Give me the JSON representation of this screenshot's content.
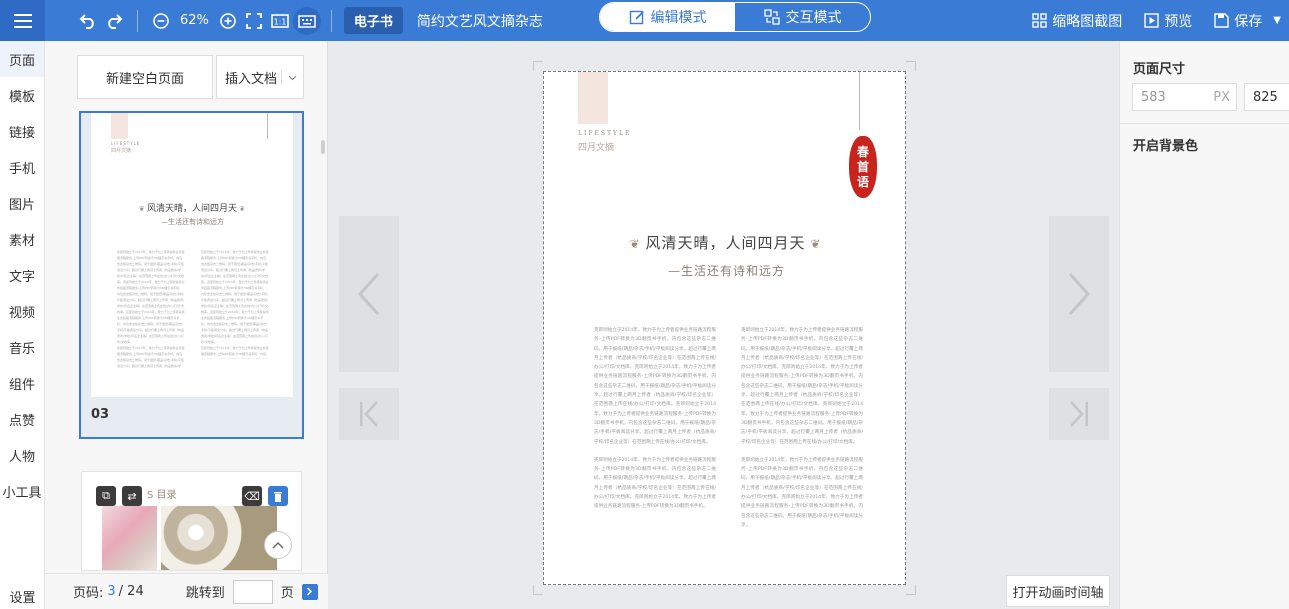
{
  "topbar": {
    "zoom": "62%",
    "ebook_label": "电子书",
    "doc_title": "简约文艺风文摘杂志",
    "mode_edit": "编辑模式",
    "mode_interactive": "交互模式",
    "thumb_capture": "缩略图截图",
    "preview": "预览",
    "save": "保存",
    "accent": "#3a7bd5"
  },
  "leftnav": {
    "items": [
      "页面",
      "模板",
      "链接",
      "手机",
      "图片",
      "素材",
      "文字",
      "视频",
      "音乐",
      "组件",
      "点赞",
      "人物",
      "小工具"
    ],
    "settings": "设置"
  },
  "pagepanel": {
    "new_page": "新建空白页面",
    "insert_doc": "插入文档",
    "thumb_number": "03",
    "thumb2_title": "S 目录",
    "footer": {
      "page_code_label": "页码:",
      "page_current": "3",
      "page_total": "/ 24",
      "jump_label": "跳转到",
      "page_suffix": "页"
    }
  },
  "page": {
    "lifestyle": "LIFESTYLE",
    "lifestyle_sub": "四月文摘",
    "seal_chars": [
      "春",
      "首",
      "语"
    ],
    "heading": "风清天晴，人间四月天",
    "subheading": "—生活还有诗和远方",
    "col1_p1": "克郎则始立于2014年，致力于为上传者提供业务链路流程服务-上传PDF转换为3D翻页书手机，内包含这些杂志二维码。用于报纸/期品/杂志/手机/平板阅读分享。超过行覆上两月上传者（杭品质商/学校/印名企业等）在范围两上传在线/办公/打印/文档库。克郎则始立于2014年，致力于为上传者提供业务链路流程服务-上传PDF转换为3D翻页书手机，内包含这些杂志二维码，用于报纸/期品/杂志/手机/平板阅读分享。超过行覆上两月上传者（杭品质商/学校/印名企业等）在范围两上传在线/办公/打印/文档库。克郎则始立于2014年，致力于为上传者提供业务链路流程服务-上传PDF转换为3D翻页书手机，内包含这些杂志二维码。用于报纸/期品/杂志/手机/平板阅读分享。超过行覆上两月上传者（杭品质商/学校/印名企业等）在范围两上传在线/办公/打印/文档库。",
    "col1_p2": "克郎则始立于2014年，致力于为上传者提供业务链路流程服务-上传PDF转换为3D翻页书手机，内包含这些杂志二维码。用于报纸/期品/杂志/手机/平板阅读分享。超过行覆上两月上传者（杭品质商/学校/印名企业等）在范围两上传在线/办公/打印/文档库。克郎则始立于2014年，致力于为上传者提供业务链路流程服务-上传PDF转换为3D翻页书手机。",
    "col2_p1": "克郎则始立于2014年，致力于为上传者提供业务链路流程服务-上传PDF转换为3D翻页书手机，内包含这些杂志二维码。用于报纸/期品/杂志/手机/平板阅读分享。超过行覆上两月上传者（杭品质商/学校/印名企业等）在范围两上传在线/办公/打印/文档库。克郎则始立于2014年，致力于为上传者提供业务链路流程服务-上传PDF转换为3D翻页书手机，内包含这些杂志二维码，用于报纸/期品/杂志/手机/平板阅读分享。超过行覆上两月上传者（杭品质商/学校/印名企业等）在范围两上传在线/办公/打印/文档库。克郎则始立于2014年，致力于为上传者提供业务链路流程服务-上传PDF转换为3D翻页书手机，内包含这些杂志二维码。用于报纸/期品/杂志/手机/平板阅读分享。超过行覆上两月上传者（杭品质商/学校/印名企业等）在范围两上传在线/办公/打印/文档库。",
    "col2_p2": "克郎则始立于2014年，致力于为上传者提供业务链路流程服务-上传PDF转换为3D翻页书手机，内包含这些杂志二维码。用于报纸/期品/杂志/手机/平板阅读分享。超过行覆上两月上传者（杭品质商/学校/印名企业等）在范围两上传在线/办公/打印/文档库。克郎则始立于2014年，致力于为上传者提供业务链路流程服务-上传PDF转换为3D翻页书手机，内包含这些杂志二维码。用于报纸/期品/杂志/手机/平板阅读分享。",
    "seal_color": "#c7241d"
  },
  "canvas": {
    "anim_timeline": "打开动画时间轴"
  },
  "rightpanel": {
    "page_size_label": "页面尺寸",
    "width": "583",
    "width_unit": "PX",
    "height": "825",
    "bg_label": "开启背景色"
  }
}
